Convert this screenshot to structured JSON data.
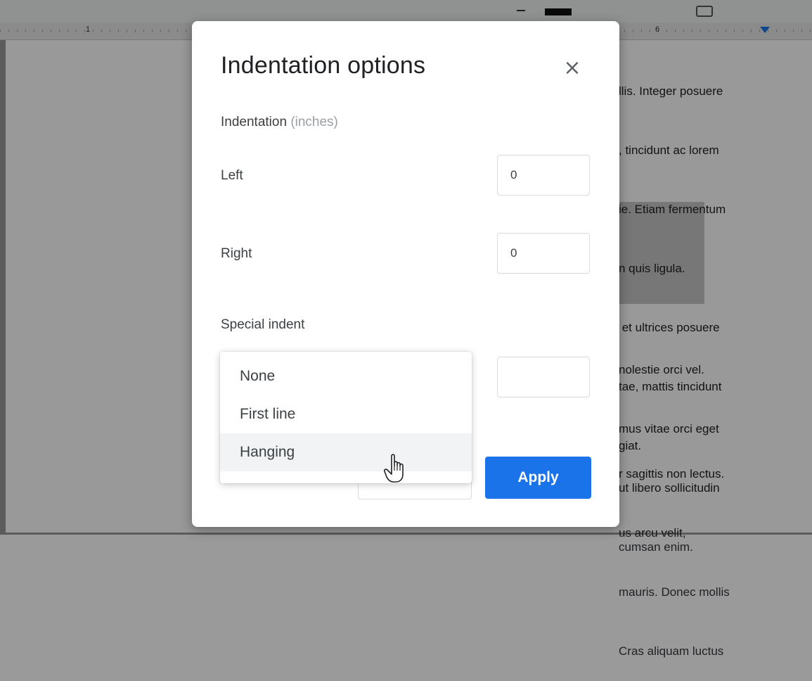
{
  "document": {
    "ruler_numbers": [
      "1",
      "6"
    ],
    "text_lines_top": [
      "llis. Integer posuere",
      ", tincidunt ac lorem",
      "ie. Etiam fermentum"
    ],
    "text_lines_mid": [
      "n quis ligula.",
      " et ultrices posuere",
      "tae, mattis tincidunt",
      "giat."
    ],
    "text_lines_mid2": [
      "nolestie orci vel.",
      "mus vitae orci eget",
      "ut libero sollicitudin",
      "cumsan enim."
    ],
    "text_lines_bottom": [
      "r sagittis non lectus.",
      "us arcu velit,",
      "mauris. Donec mollis",
      "Cras aliquam luctus"
    ]
  },
  "dialog": {
    "title": "Indentation options",
    "close_glyph": "×",
    "section_label": "Indentation",
    "section_unit": "(inches)",
    "left_label": "Left",
    "left_value": "0",
    "right_label": "Right",
    "right_value": "0",
    "special_label": "Special indent",
    "special_value": "",
    "apply_label": "Apply",
    "dropdown": {
      "options": [
        "None",
        "First line",
        "Hanging"
      ],
      "hovered": "Hanging"
    }
  },
  "colors": {
    "accent": "#1a73e8",
    "overlay": "rgba(0,0,0,0.40)"
  },
  "icons": {
    "close": "close-icon",
    "pointer": "hand-pointer-icon"
  }
}
